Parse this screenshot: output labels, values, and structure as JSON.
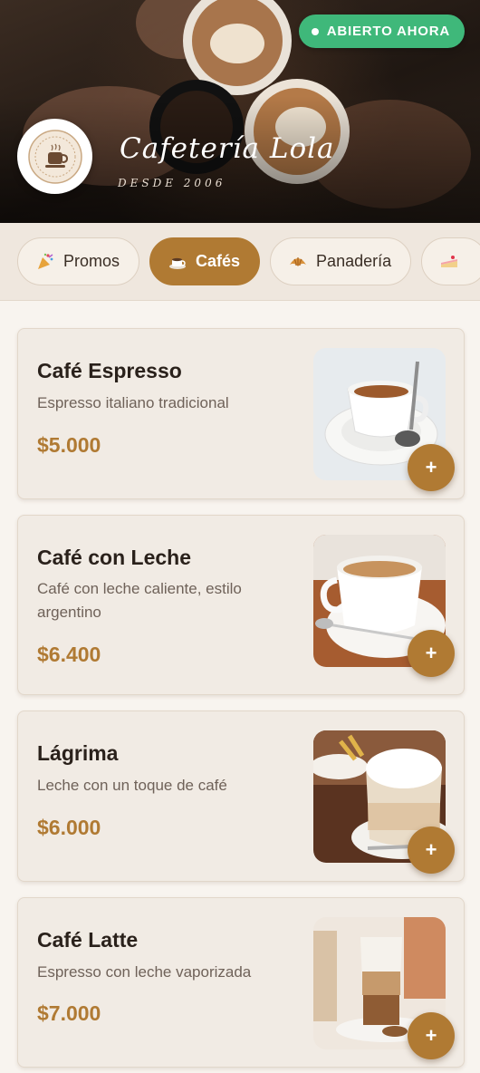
{
  "header": {
    "status": "ABIERTO AHORA",
    "brand_name": "Cafetería Lola",
    "since": "DESDE 2006",
    "logo_icon": "cafe-logo-icon"
  },
  "categories": [
    {
      "label": "Promos",
      "icon": "party-popper-icon",
      "active": false
    },
    {
      "label": "Cafés",
      "icon": "coffee-cup-icon",
      "active": true
    },
    {
      "label": "Panadería",
      "icon": "croissant-icon",
      "active": false
    },
    {
      "label": "",
      "icon": "cake-slice-icon",
      "active": false
    }
  ],
  "products": [
    {
      "name": "Café Espresso",
      "description": "Espresso italiano tradicional",
      "price": "$5.000",
      "add_label": "+"
    },
    {
      "name": "Café con Leche",
      "description": "Café con leche caliente, estilo argentino",
      "price": "$6.400",
      "add_label": "+"
    },
    {
      "name": "Lágrima",
      "description": "Leche con un toque de café",
      "price": "$6.000",
      "add_label": "+"
    },
    {
      "name": "Café Latte",
      "description": "Espresso con leche vaporizada",
      "price": "$7.000",
      "add_label": "+"
    }
  ],
  "colors": {
    "accent": "#b07a33",
    "status_green": "#3fb87a",
    "background": "#f8f4ef"
  }
}
